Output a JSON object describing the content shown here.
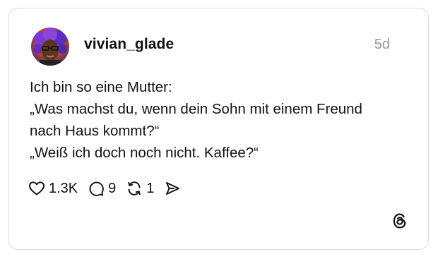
{
  "post": {
    "username": "vivian_glade",
    "time": "5d",
    "lines": [
      "Ich bin so eine Mutter:",
      "„Was machst du, wenn dein Sohn mit einem Freund",
      "nach Haus kommt?“",
      "„Weiß ich doch noch nicht. Kaffee?“"
    ]
  },
  "actions": {
    "likes": "1.3K",
    "replies": "9",
    "reposts": "1"
  },
  "icons": {
    "like": "heart-icon",
    "reply": "comment-bubble-icon",
    "repost": "repost-arrows-icon",
    "share": "send-icon",
    "brand": "threads-logo-icon"
  },
  "colors": {
    "text": "#111111",
    "muted": "#9a9a9a",
    "border": "#d9d9d9"
  }
}
